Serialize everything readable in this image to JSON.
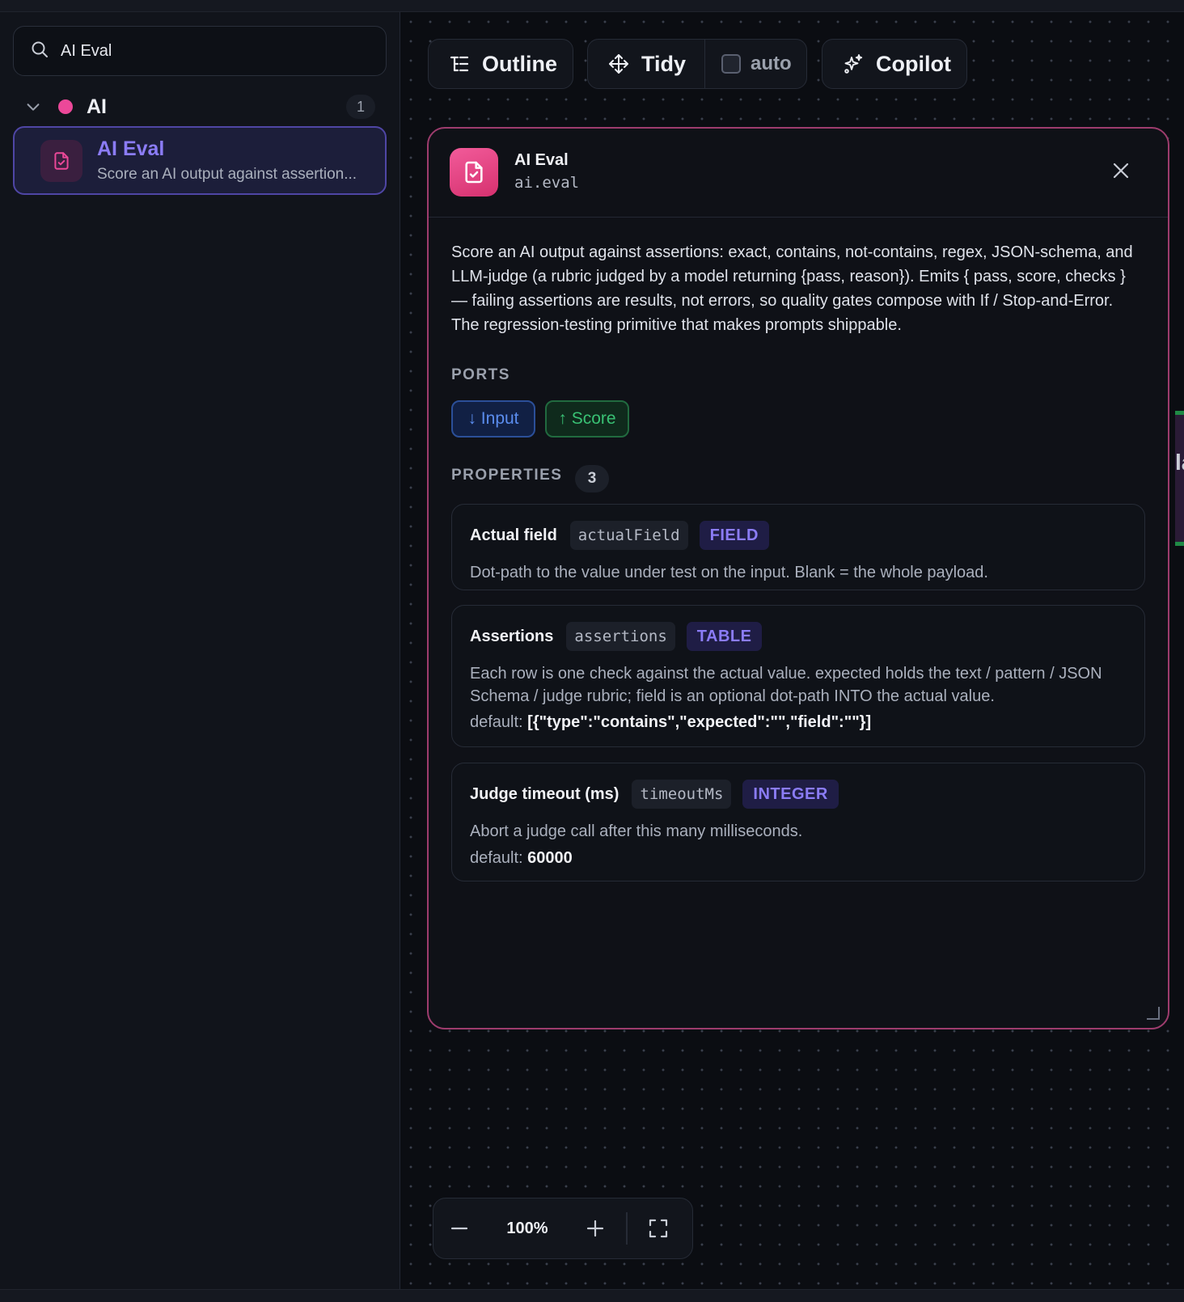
{
  "sidebar": {
    "search": {
      "value": "AI Eval",
      "icon": "search-icon"
    },
    "group": {
      "label": "AI",
      "count": "1",
      "color": "#ec4899"
    },
    "item": {
      "title": "AI Eval",
      "subtitle": "Score an AI output against assertion..."
    }
  },
  "toolbar": {
    "outline_label": "Outline",
    "tidy_label": "Tidy",
    "auto_label": "auto",
    "auto_checked": false,
    "copilot_label": "Copilot"
  },
  "panel": {
    "title": "AI Eval",
    "code": "ai.eval",
    "description": "Score an AI output against assertions: exact, contains, not-contains, regex, JSON-schema, and LLM-judge (a rubric judged by a model returning {pass, reason}). Emits { pass, score, checks } — failing assertions are results, not errors, so quality gates compose with If / Stop-and-Error. The regression-testing primitive that makes prompts shippable.",
    "ports_label": "PORTS",
    "ports": {
      "input": "↓ Input",
      "output": "↑ Score"
    },
    "properties_label": "PROPERTIES",
    "properties_count": "3",
    "properties": [
      {
        "name": "Actual field",
        "key": "actualField",
        "type": "FIELD",
        "description": "Dot-path to the value under test on the input. Blank = the whole payload."
      },
      {
        "name": "Assertions",
        "key": "assertions",
        "type": "TABLE",
        "description": "Each row is one check against the actual value. expected holds the text / pattern / JSON Schema / judge rubric; field is an optional dot-path INTO the actual value.",
        "default_label": "default:",
        "default_value": "[{\"type\":\"contains\",\"expected\":\"\",\"field\":\"\"}]"
      },
      {
        "name": "Judge timeout (ms)",
        "key": "timeoutMs",
        "type": "INTEGER",
        "description": "Abort a judge call after this many milliseconds.",
        "default_label": "default:",
        "default_value": "60000"
      }
    ]
  },
  "peek_node": {
    "label": "la"
  },
  "zoom": {
    "value": "100%"
  },
  "colors": {
    "accent": "#8b7cf6",
    "brand": "#ec4899",
    "input_port": "#5b8def",
    "output_port": "#39c174"
  }
}
